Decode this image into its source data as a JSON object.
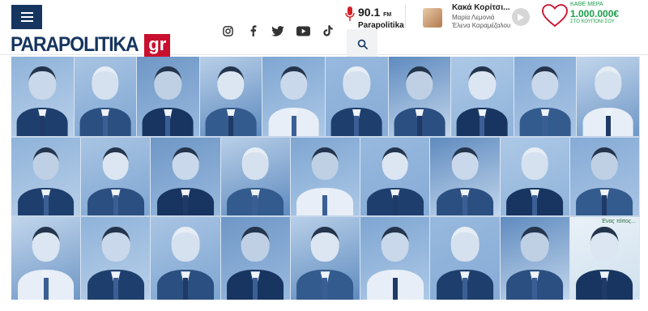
{
  "header": {
    "menu_icon": "hamburger-menu-icon",
    "logo": {
      "text": "PARAPOLITIKA",
      "suffix": "gr",
      "brand_color": "#16355f",
      "accent_color": "#c8102e"
    },
    "social": [
      "instagram-icon",
      "facebook-icon",
      "twitter-icon",
      "youtube-icon",
      "tiktok-icon"
    ],
    "radio": {
      "frequency": "90.1",
      "unit": "FM",
      "name": "Parapolitika",
      "icon": "microphone-icon"
    },
    "search_icon": "search-icon",
    "now_playing": {
      "title": "Κακά Κορίτσι...",
      "hosts": "Μαρία Λεμονιά",
      "hosts2": "Έλενα Καραμέζαλου",
      "play_icon": "play-icon"
    },
    "lotto": {
      "top": "ΚΑΘΕ ΜΕΡΑ",
      "amount": "1.000.000€",
      "bottom": "ΣΤΟ ΚΟΥΠΟΝΙ ΣΟΥ",
      "icon": "heart-icon",
      "color": "#1a9e4b"
    }
  },
  "collage": {
    "tint": "#2f63a3",
    "banner_text": "Ένας τόπος...",
    "rows": [
      {
        "count": 10
      },
      {
        "count": 9
      },
      {
        "count": 9
      }
    ]
  }
}
